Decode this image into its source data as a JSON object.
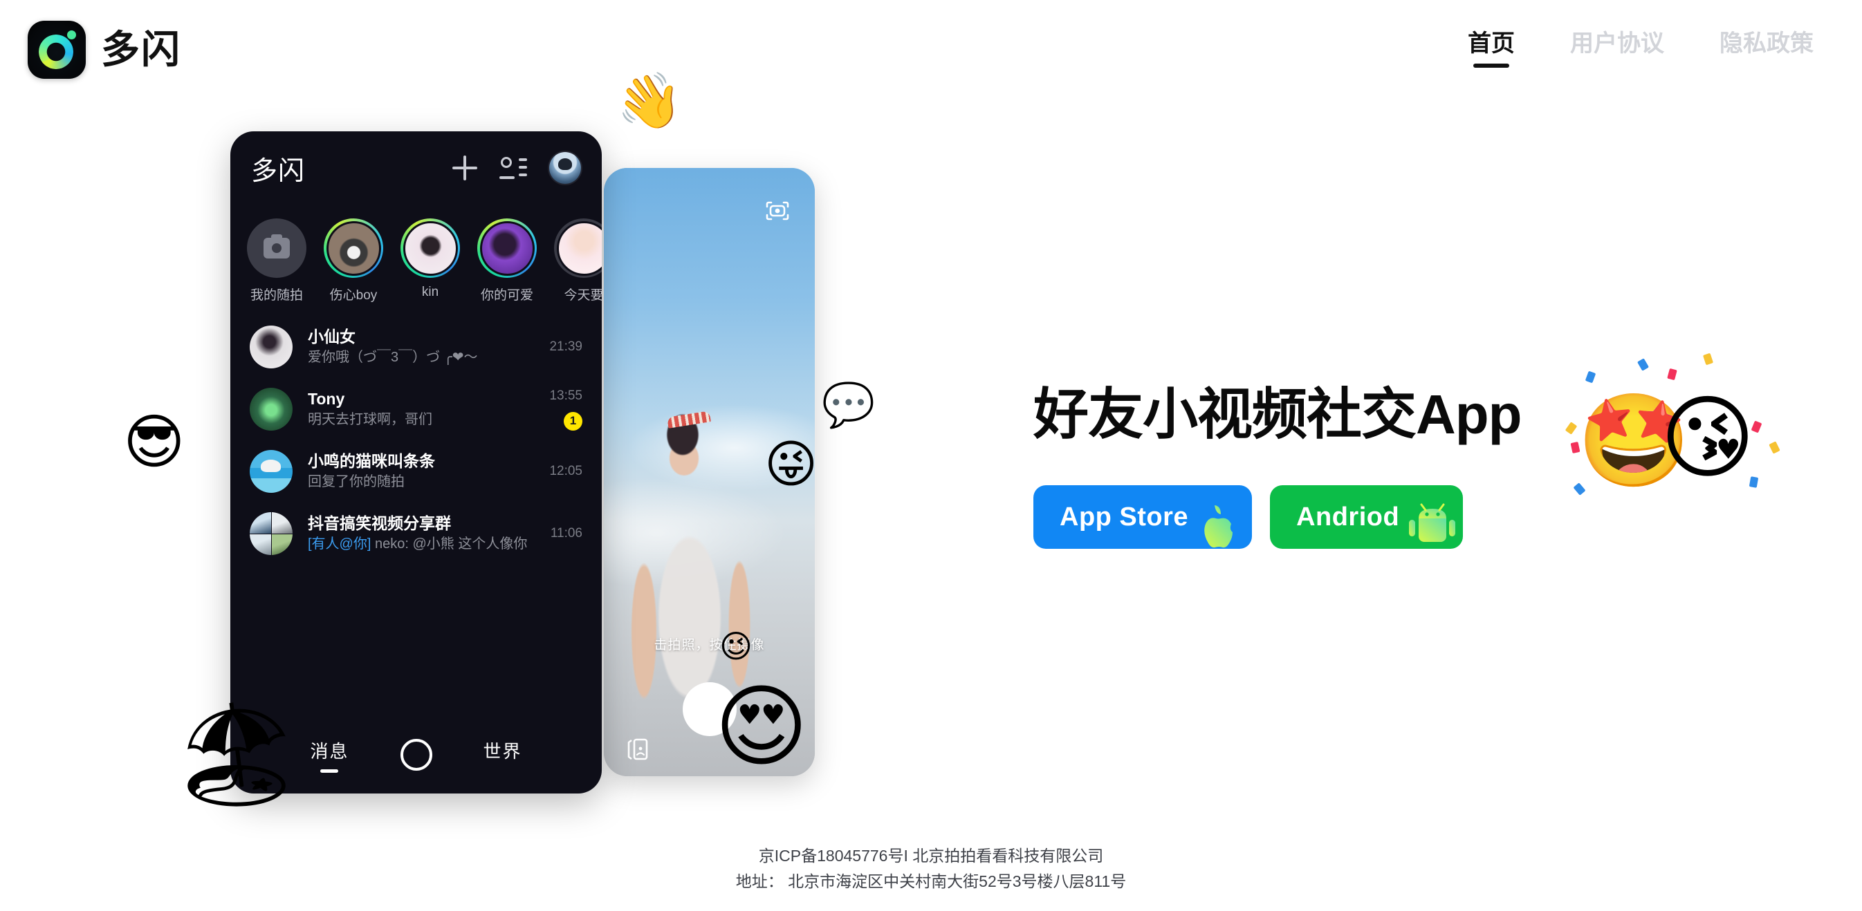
{
  "brand": {
    "name": "多闪",
    "logo_icon": "duoshan-logo-icon"
  },
  "nav": {
    "items": [
      {
        "label": "首页",
        "active": true
      },
      {
        "label": "用户协议",
        "active": false
      },
      {
        "label": "隐私政策",
        "active": false
      }
    ]
  },
  "phone_messages": {
    "header": {
      "title": "多闪",
      "add_icon": "plus-icon",
      "contacts_icon": "contacts-icon",
      "avatar_icon": "user-avatar"
    },
    "stories": [
      {
        "label": "我的随拍",
        "type": "camera",
        "ring": "none"
      },
      {
        "label": "伤心boy",
        "type": "photo",
        "ring": "gradient"
      },
      {
        "label": "kin",
        "type": "photo",
        "ring": "gradient"
      },
      {
        "label": "你的可爱",
        "type": "photo",
        "ring": "gradient"
      },
      {
        "label": "今天要",
        "type": "photo",
        "ring": "seen"
      }
    ],
    "chats": [
      {
        "name": "小仙女",
        "preview": "爱你哦（づ￣3￣）づ ╭❤～",
        "time": "21:39",
        "unread": ""
      },
      {
        "name": "Tony",
        "preview": "明天去打球啊，哥们",
        "time": "13:55",
        "unread": "1"
      },
      {
        "name": "小鸣的猫咪叫条条",
        "preview": "回复了你的随拍",
        "time": "12:05",
        "unread": ""
      },
      {
        "name": "抖音搞笑视频分享群",
        "preview_mention": "[有人@你]",
        "preview": " neko: @小熊 这个人像你",
        "time": "11:06",
        "unread": ""
      }
    ],
    "tabs": [
      {
        "label": "消息",
        "active": true
      },
      {
        "label": "",
        "active": false,
        "icon": "shutter-icon"
      },
      {
        "label": "世界",
        "active": false
      }
    ]
  },
  "phone_camera": {
    "flip_icon": "flip-camera-icon",
    "hint": "击拍照，按住摄像",
    "shutter_icon": "shutter-button",
    "gallery_icon": "gallery-icon"
  },
  "hero": {
    "title": "好友小视频社交App",
    "buttons": [
      {
        "label": "App Store",
        "icon": "apple-icon",
        "color": "#1187f4"
      },
      {
        "label": "Andriod",
        "icon": "android-icon",
        "color": "#0cbd48"
      }
    ]
  },
  "decorations": [
    {
      "name": "waving-hand-emoji",
      "glyph": "👋"
    },
    {
      "name": "speech-bubble-check-emoji",
      "glyph": "💬"
    },
    {
      "name": "winking-tongue-emoji",
      "glyph": "😜"
    },
    {
      "name": "sunglasses-emoji",
      "glyph": "😎"
    },
    {
      "name": "heart-eyes-emoji",
      "glyph": "😍"
    },
    {
      "name": "beach-umbrella-emoji",
      "glyph": "🏖"
    },
    {
      "name": "crown-face-sticker",
      "glyph": "😉"
    },
    {
      "name": "partying-face-emoji",
      "glyph": "🤩"
    },
    {
      "name": "kissing-heart-emoji",
      "glyph": "😘"
    }
  ],
  "footer": {
    "line1": "京ICP备18045776号I 北京拍拍看看科技有限公司",
    "line2": "地址： 北京市海淀区中关村南大街52号3号楼八层811号"
  }
}
